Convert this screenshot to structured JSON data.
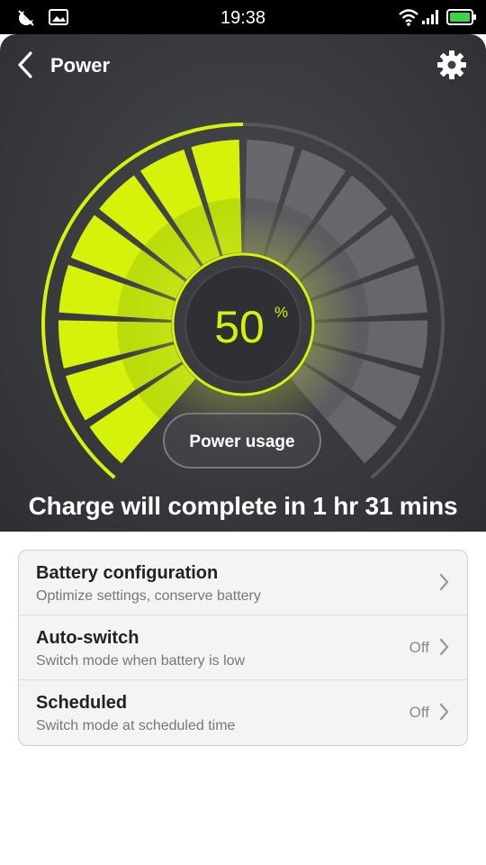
{
  "status_bar": {
    "time": "19:38",
    "left_icons": [
      "moon-icon",
      "image-icon"
    ],
    "right_icons": [
      "wifi-icon",
      "signal-icon",
      "battery-charging-icon"
    ]
  },
  "header": {
    "title": "Power",
    "back_icon": "chevron-left-icon",
    "settings_icon": "gear-icon"
  },
  "gauge": {
    "percent": "50",
    "percent_sign": "%",
    "level": 0.5,
    "accent_color": "#d6f20a",
    "inactive_color": "#6b6c70"
  },
  "power_usage_label": "Power usage",
  "charge_status": "Charge will complete in 1 hr 31 mins",
  "settings": [
    {
      "title": "Battery configuration",
      "subtitle": "Optimize settings, conserve battery",
      "value": ""
    },
    {
      "title": "Auto-switch",
      "subtitle": "Switch mode when battery is low",
      "value": "Off"
    },
    {
      "title": "Scheduled",
      "subtitle": "Switch mode at scheduled time",
      "value": "Off"
    }
  ]
}
